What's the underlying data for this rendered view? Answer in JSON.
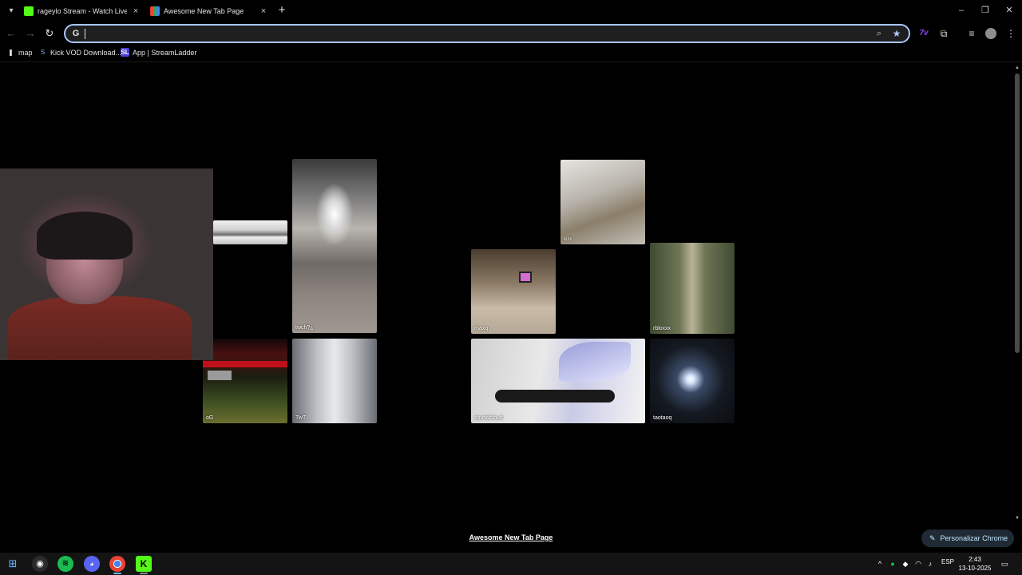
{
  "browser": {
    "tabs": [
      {
        "title": "rageylo Stream - Watch Live on",
        "favicon_color": "#53fc18"
      },
      {
        "title": "Awesome New Tab Page",
        "favicon_color": "#34a853"
      }
    ],
    "new_tab_icon": "plus-icon",
    "window_controls": [
      "minimize-icon",
      "restore-icon",
      "close-icon"
    ],
    "omnibox": {
      "value": "",
      "placeholder": ""
    },
    "toolbar_icons": [
      "zoom-icon",
      "star-icon",
      "7tv-extension-icon",
      "extensions-icon",
      "media-icon",
      "profile-avatar",
      "menu-icon"
    ],
    "seventv_label": "7v",
    "bookmarks": [
      {
        "label": "map",
        "icon": "map-pin-icon"
      },
      {
        "label": "Kick VOD Download...",
        "icon": "kick-icon"
      },
      {
        "label": "App | StreamLadder",
        "icon": "streamladder-icon",
        "badge": "SL"
      }
    ]
  },
  "page": {
    "tiles": [
      {
        "key": "bridge",
        "caption": ""
      },
      {
        "key": "tunnel",
        "caption": "twch?¿"
      },
      {
        "key": "og",
        "caption": "oG"
      },
      {
        "key": "twt",
        "caption": "TwT"
      },
      {
        "key": "uu",
        "caption": "u.u"
      },
      {
        "key": "maxq",
        "caption": "maxq"
      },
      {
        "key": "rbloxxx",
        "caption": "rbloxxx"
      },
      {
        "key": "soundcloud",
        "caption": "soundcloud"
      },
      {
        "key": "taotaoq",
        "caption": "taotaoq"
      }
    ],
    "footer_link": "Awesome New Tab Page",
    "customize_label": "Personalizar Chrome"
  },
  "taskbar": {
    "apps": [
      "windows-start-icon",
      "obs-icon",
      "spotify-icon",
      "discord-icon",
      "chrome-icon",
      "kick-icon"
    ],
    "language": "ESP",
    "time": "2:43",
    "date": "13-10-2025"
  },
  "colors": {
    "accent": "#a8c7fa",
    "kick_green": "#53fc18",
    "background": "#000000"
  }
}
